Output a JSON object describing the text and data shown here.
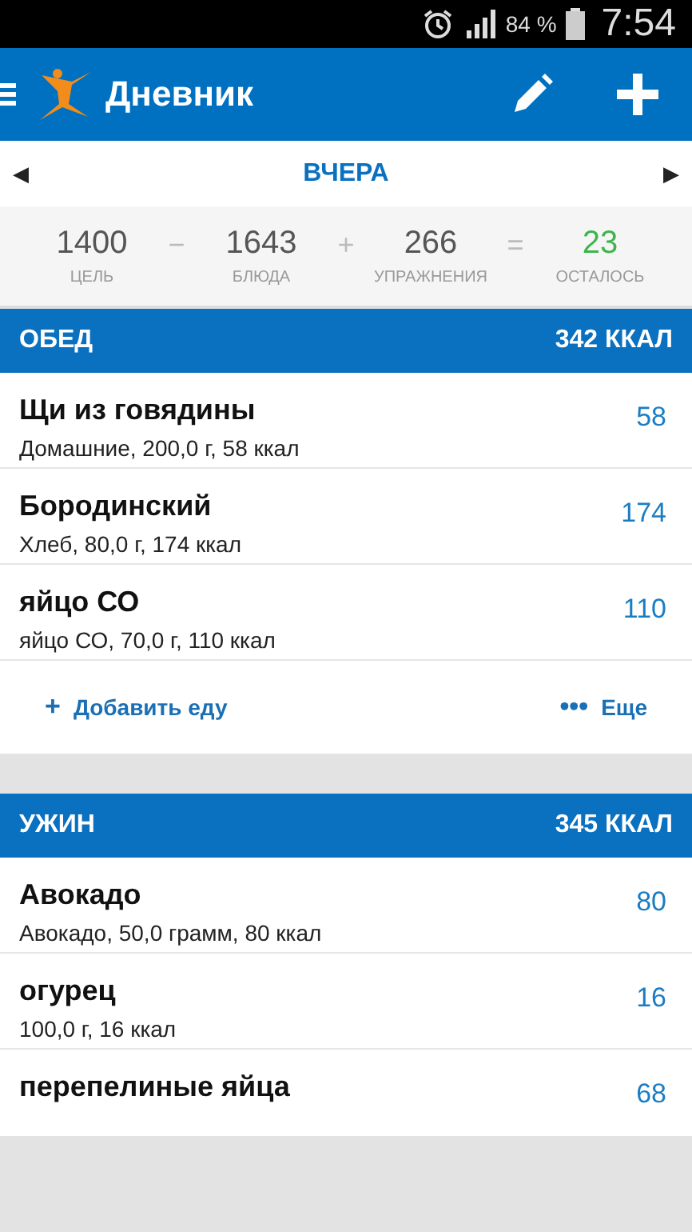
{
  "status_bar": {
    "battery": "84 %",
    "time": "7:54"
  },
  "app_bar": {
    "title": "Дневник"
  },
  "date_nav": {
    "prev": "◀",
    "label": "ВЧЕРА",
    "next": "▶"
  },
  "summary": [
    {
      "kind": "term",
      "value": "1400",
      "label": "ЦЕЛЬ"
    },
    {
      "kind": "operator",
      "value": "−"
    },
    {
      "kind": "term",
      "value": "1643",
      "label": "БЛЮДА"
    },
    {
      "kind": "operator",
      "value": "+"
    },
    {
      "kind": "term",
      "value": "266",
      "label": "УПРАЖНЕНИЯ"
    },
    {
      "kind": "operator",
      "value": "="
    },
    {
      "kind": "result",
      "value": "23",
      "label": "ОСТАЛОСЬ"
    }
  ],
  "meals": [
    {
      "name": "ОБЕД",
      "total": "342 ККАЛ",
      "items": [
        {
          "name": "Щи из говядины",
          "detail": "Домашние, 200,0 г, 58 ккал",
          "calories": "58"
        },
        {
          "name": "Бородинский",
          "detail": "Хлеб, 80,0 г, 174 ккал",
          "calories": "174"
        },
        {
          "name": "яйцо СО",
          "detail": "яйцо СО, 70,0 г, 110 ккал",
          "calories": "110"
        }
      ],
      "actions": [
        {
          "icon": "+",
          "label": "Добавить еду"
        },
        {
          "icon": "•••",
          "label": "Еще"
        }
      ]
    },
    {
      "name": "УЖИН",
      "total": "345 ККАЛ",
      "items": [
        {
          "name": "Авокадо",
          "detail": "Авокадо, 50,0 грамм, 80 ккал",
          "calories": "80"
        },
        {
          "name": "огурец",
          "detail": "100,0 г, 16 ккал",
          "calories": "16"
        },
        {
          "name": "перепелиные яйца",
          "calories": "68"
        }
      ]
    }
  ]
}
